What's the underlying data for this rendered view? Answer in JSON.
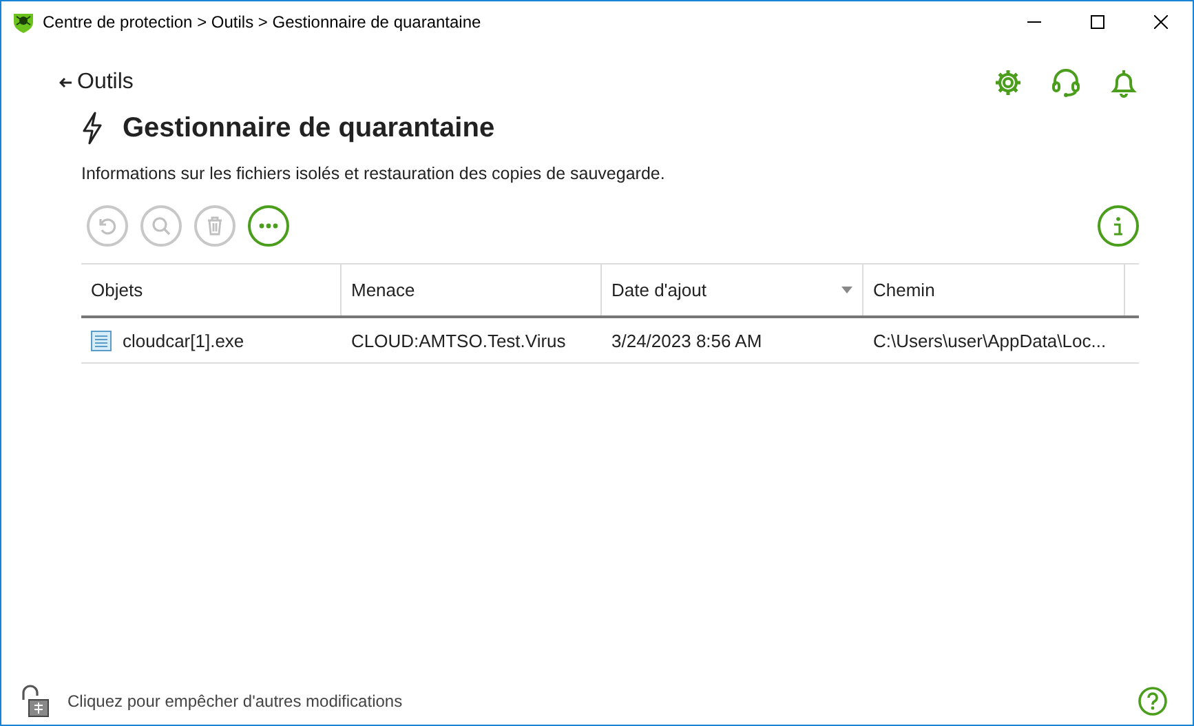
{
  "window": {
    "title": "Centre de protection > Outils > Gestionnaire de quarantaine"
  },
  "back_link": {
    "label": "Outils"
  },
  "page": {
    "title": "Gestionnaire de quarantaine",
    "description": "Informations sur les fichiers isolés et restauration des copies de sauvegarde."
  },
  "toolbar": [
    {
      "kind": "restore",
      "disabled": true
    },
    {
      "kind": "scan",
      "disabled": true
    },
    {
      "kind": "delete",
      "disabled": true
    },
    {
      "kind": "more",
      "disabled": false
    }
  ],
  "table": {
    "columns": [
      {
        "label": "Objets",
        "sorted": false
      },
      {
        "label": "Menace",
        "sorted": false
      },
      {
        "label": "Date d'ajout",
        "sorted": true
      },
      {
        "label": "Chemin",
        "sorted": false
      }
    ],
    "rows": [
      {
        "cells": [
          "cloudcar[1].exe",
          "CLOUD:AMTSO.Test.Virus",
          "3/24/2023 8:56 AM",
          "C:\\Users\\user\\AppData\\Loc..."
        ]
      }
    ]
  },
  "status_bar": {
    "text": "Cliquez pour empêcher d'autres modifications",
    "locked": false
  }
}
